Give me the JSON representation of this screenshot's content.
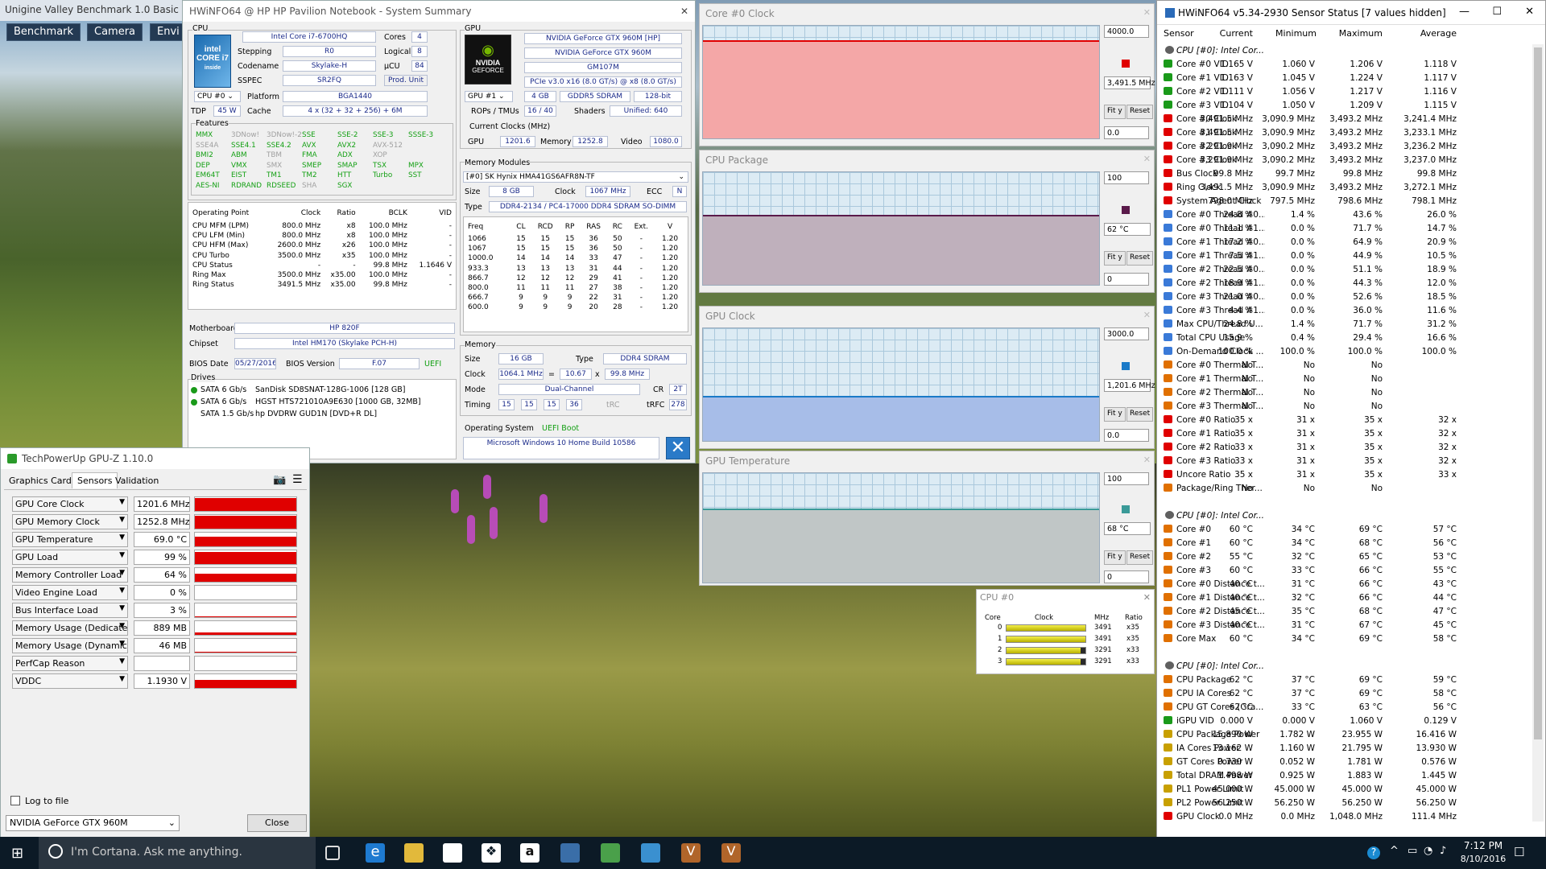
{
  "unigine": {
    "title": "Unigine Valley Benchmark 1.0 Basic (D",
    "tabs": [
      "Benchmark",
      "Camera",
      "Envi"
    ]
  },
  "summary": {
    "title": "HWiNFO64 @ HP HP Pavilion Notebook - System Summary",
    "cpu": {
      "section": "CPU",
      "name": "Intel Core i7-6700HQ",
      "cores_l": "Cores",
      "cores": "4",
      "stepping_l": "Stepping",
      "stepping": "R0",
      "logical_l": "Logical",
      "logical": "8",
      "codename_l": "Codename",
      "codename": "Skylake-H",
      "ucu_l": "µCU",
      "ucu": "84",
      "sspec_l": "SSPEC",
      "sspec": "SR2FQ",
      "produnit": "Prod. Unit",
      "cpusel": "CPU #0",
      "platform_l": "Platform",
      "platform": "BGA1440",
      "tdp_l": "TDP",
      "tdp": "45 W",
      "cache_l": "Cache",
      "cache": "4 x (32 + 32 + 256) + 6M",
      "features_l": "Features",
      "features": [
        [
          "MMX",
          "g"
        ],
        [
          "3DNow!",
          "d"
        ],
        [
          "3DNow!-2",
          "d"
        ],
        [
          "SSE",
          "g"
        ],
        [
          "SSE-2",
          "g"
        ],
        [
          "SSE-3",
          "g"
        ],
        [
          "SSSE-3",
          "g"
        ],
        [
          "SSE4A",
          "d"
        ],
        [
          "SSE4.1",
          "g"
        ],
        [
          "SSE4.2",
          "g"
        ],
        [
          "AVX",
          "g"
        ],
        [
          "AVX2",
          "g"
        ],
        [
          "AVX-512",
          "d"
        ],
        [
          "",
          "d"
        ],
        [
          "BMI2",
          "g"
        ],
        [
          "ABM",
          "g"
        ],
        [
          "TBM",
          "d"
        ],
        [
          "FMA",
          "g"
        ],
        [
          "ADX",
          "g"
        ],
        [
          "XOP",
          "d"
        ],
        [
          "",
          "d"
        ],
        [
          "DEP",
          "g"
        ],
        [
          "VMX",
          "g"
        ],
        [
          "SMX",
          "d"
        ],
        [
          "SMEP",
          "g"
        ],
        [
          "SMAP",
          "g"
        ],
        [
          "TSX",
          "g"
        ],
        [
          "MPX",
          "g"
        ],
        [
          "EM64T",
          "g"
        ],
        [
          "EIST",
          "g"
        ],
        [
          "TM1",
          "g"
        ],
        [
          "TM2",
          "g"
        ],
        [
          "HTT",
          "g"
        ],
        [
          "Turbo",
          "g"
        ],
        [
          "SST",
          "g"
        ],
        [
          "AES-NI",
          "g"
        ],
        [
          "RDRAND",
          "g"
        ],
        [
          "RDSEED",
          "g"
        ],
        [
          "SHA",
          "d"
        ],
        [
          "SGX",
          "g"
        ]
      ],
      "op_head": [
        "Operating Point",
        "Clock",
        "Ratio",
        "BCLK",
        "VID"
      ],
      "op_rows": [
        [
          "CPU MFM (LPM)",
          "800.0 MHz",
          "x8",
          "100.0 MHz",
          "-"
        ],
        [
          "CPU LFM (Min)",
          "800.0 MHz",
          "x8",
          "100.0 MHz",
          "-"
        ],
        [
          "CPU HFM (Max)",
          "2600.0 MHz",
          "x26",
          "100.0 MHz",
          "-"
        ],
        [
          "CPU Turbo",
          "3500.0 MHz",
          "x35",
          "100.0 MHz",
          "-"
        ],
        [
          "CPU Status",
          "-",
          "-",
          "99.8 MHz",
          "1.1646 V"
        ],
        [
          "Ring Max",
          "3500.0 MHz",
          "x35.00",
          "100.0 MHz",
          "-"
        ],
        [
          "Ring Status",
          "3491.5 MHz",
          "x35.00",
          "99.8 MHz",
          "-"
        ]
      ],
      "mobo_l": "Motherboard",
      "mobo": "HP 820F",
      "chipset_l": "Chipset",
      "chipset": "Intel HM170 (Skylake PCH-H)",
      "biosdate_l": "BIOS Date",
      "biosdate": "05/27/2016",
      "biosver_l": "BIOS Version",
      "biosver": "F.07",
      "uefi": "UEFI",
      "drives_l": "Drives",
      "drives": [
        [
          "SATA 6 Gb/s",
          "SanDisk SD8SNAT-128G-1006 [128 GB]"
        ],
        [
          "SATA 6 Gb/s",
          "HGST HTS721010A9E630 [1000 GB, 32MB]"
        ],
        [
          "SATA 1.5 Gb/s",
          "hp      DVDRW GUD1N [DVD+R DL]"
        ]
      ]
    },
    "gpu": {
      "section": "GPU",
      "name1": "NVIDIA GeForce GTX 960M [HP]",
      "name2": "NVIDIA GeForce GTX 960M",
      "chip": "GM107M",
      "pcie": "PCIe v3.0 x16 (8.0 GT/s) @ x8 (8.0 GT/s)",
      "gpusel": "GPU #1",
      "mem": "4 GB",
      "memtype": "GDDR5 SDRAM",
      "bus": "128-bit",
      "rops_l": "ROPs / TMUs",
      "rops": "16 / 40",
      "shaders_l": "Shaders",
      "shaders": "Unified: 640",
      "clocks_l": "Current Clocks (MHz)",
      "gpu_l": "GPU",
      "gpu_clk": "1201.6",
      "memory_l": "Memory",
      "mem_clk": "1252.8",
      "video_l": "Video",
      "video_clk": "1080.0",
      "logo": "NVIDIA",
      "logo2": "GEFORCE"
    },
    "modules": {
      "section": "Memory Modules",
      "sel": "[#0] SK Hynix HMA41GS6AFR8N-TF",
      "size_l": "Size",
      "size": "8 GB",
      "clock_l": "Clock",
      "clock": "1067 MHz",
      "ecc_l": "ECC",
      "ecc": "N",
      "type_l": "Type",
      "type": "DDR4-2134 / PC4-17000 DDR4 SDRAM SO-DIMM",
      "t_head": [
        "Freq",
        "CL",
        "RCD",
        "RP",
        "RAS",
        "RC",
        "Ext.",
        "V"
      ],
      "t_rows": [
        [
          "1066",
          "15",
          "15",
          "15",
          "36",
          "50",
          "-",
          "1.20"
        ],
        [
          "1067",
          "15",
          "15",
          "15",
          "36",
          "50",
          "-",
          "1.20"
        ],
        [
          "1000.0",
          "14",
          "14",
          "14",
          "33",
          "47",
          "-",
          "1.20"
        ],
        [
          "933.3",
          "13",
          "13",
          "13",
          "31",
          "44",
          "-",
          "1.20"
        ],
        [
          "866.7",
          "12",
          "12",
          "12",
          "29",
          "41",
          "-",
          "1.20"
        ],
        [
          "800.0",
          "11",
          "11",
          "11",
          "27",
          "38",
          "-",
          "1.20"
        ],
        [
          "666.7",
          "9",
          "9",
          "9",
          "22",
          "31",
          "-",
          "1.20"
        ],
        [
          "600.0",
          "9",
          "9",
          "9",
          "20",
          "28",
          "-",
          "1.20"
        ]
      ]
    },
    "memory": {
      "section": "Memory",
      "size_l": "Size",
      "size": "16 GB",
      "type_l": "Type",
      "type": "DDR4 SDRAM",
      "clock_l": "Clock",
      "clock": "1064.1 MHz",
      "eq": "=",
      "mult": "10.67",
      "x": "x",
      "bclk": "99.8 MHz",
      "mode_l": "Mode",
      "mode": "Dual-Channel",
      "cr_l": "CR",
      "cr": "2T",
      "timing_l": "Timing",
      "t1": "15",
      "t2": "15",
      "t3": "15",
      "t4": "36",
      "trc_l": "tRC",
      "trfc_l": "tRFC",
      "trfc": "278"
    },
    "os": {
      "label": "Operating System",
      "boot": "UEFI Boot",
      "name": "Microsoft Windows 10 Home Build 10586"
    }
  },
  "graphs": [
    {
      "title": "Core #0 Clock",
      "max": "4000.0",
      "cur": "3,491.5 MHz",
      "min": "0.0",
      "color": "#f4a7a7",
      "swatch": "#e00000",
      "level": 0.87
    },
    {
      "title": "CPU Package",
      "max": "100",
      "cur": "62 °C",
      "min": "0",
      "color": "#bfb0bc",
      "swatch": "#5a1a4a",
      "level": 0.62
    },
    {
      "title": "GPU Clock",
      "max": "3000.0",
      "cur": "1,201.6 MHz",
      "min": "0.0",
      "color": "#a7bde8",
      "swatch": "#1a7ac8",
      "level": 0.4
    },
    {
      "title": "GPU Temperature",
      "max": "100",
      "cur": "68 °C",
      "min": "0",
      "color": "#c0c6c6",
      "swatch": "#3a9a98",
      "level": 0.68
    }
  ],
  "graph_buttons": {
    "fit": "Fit y",
    "reset": "Reset"
  },
  "cpu0": {
    "title": "CPU #0",
    "head": [
      "Core",
      "Clock",
      "MHz",
      "Ratio"
    ],
    "rows": [
      [
        "0",
        "3491",
        "x35"
      ],
      [
        "1",
        "3491",
        "x35"
      ],
      [
        "2",
        "3291",
        "x33"
      ],
      [
        "3",
        "3291",
        "x33"
      ]
    ]
  },
  "gpuz": {
    "title": "TechPowerUp GPU-Z 1.10.0",
    "tabs": [
      "Graphics Card",
      "Sensors",
      "Validation"
    ],
    "rows": [
      {
        "name": "GPU Core Clock",
        "value": "1201.6 MHz",
        "fill": 0.95
      },
      {
        "name": "GPU Memory Clock",
        "value": "1252.8 MHz",
        "fill": 0.95
      },
      {
        "name": "GPU Temperature",
        "value": "69.0 °C",
        "fill": 0.72
      },
      {
        "name": "GPU Load",
        "value": "99 %",
        "fill": 0.9
      },
      {
        "name": "Memory Controller Load",
        "value": "64 %",
        "fill": 0.6
      },
      {
        "name": "Video Engine Load",
        "value": "0 %",
        "fill": 0
      },
      {
        "name": "Bus Interface Load",
        "value": "3 %",
        "fill": 0.05
      },
      {
        "name": "Memory Usage (Dedicated)",
        "value": "889 MB",
        "fill": 0.2
      },
      {
        "name": "Memory Usage (Dynamic)",
        "value": "46 MB",
        "fill": 0.05
      },
      {
        "name": "PerfCap Reason",
        "value": "",
        "fill": 0
      },
      {
        "name": "VDDC",
        "value": "1.1930 V",
        "fill": 0.6
      }
    ],
    "log": "Log to file",
    "device": "NVIDIA GeForce GTX 960M",
    "close": "Close"
  },
  "hws": {
    "title": "HWiNFO64 v5.34-2930 Sensor Status [7 values hidden]",
    "cols": [
      "Sensor",
      "Current",
      "Minimum",
      "Maximum",
      "Average"
    ],
    "rows": [
      [
        "g",
        "CPU [#0]: Intel Cor...",
        "",
        "",
        "",
        ""
      ],
      [
        "v",
        "Core #0 VID",
        "1.165 V",
        "1.060 V",
        "1.206 V",
        "1.118 V"
      ],
      [
        "v",
        "Core #1 VID",
        "1.163 V",
        "1.045 V",
        "1.224 V",
        "1.117 V"
      ],
      [
        "v",
        "Core #2 VID",
        "1.111 V",
        "1.056 V",
        "1.217 V",
        "1.116 V"
      ],
      [
        "v",
        "Core #3 VID",
        "1.104 V",
        "1.050 V",
        "1.209 V",
        "1.115 V"
      ],
      [
        "c",
        "Core #0 Clock",
        "3,491.5 MHz",
        "3,090.9 MHz",
        "3,493.2 MHz",
        "3,241.4 MHz"
      ],
      [
        "c",
        "Core #1 Clock",
        "3,491.5 MHz",
        "3,090.9 MHz",
        "3,493.2 MHz",
        "3,233.1 MHz"
      ],
      [
        "c",
        "Core #2 Clock",
        "3,291.9 MHz",
        "3,090.2 MHz",
        "3,493.2 MHz",
        "3,236.2 MHz"
      ],
      [
        "c",
        "Core #3 Clock",
        "3,291.9 MHz",
        "3,090.2 MHz",
        "3,493.2 MHz",
        "3,237.0 MHz"
      ],
      [
        "c",
        "Bus Clock",
        "99.8 MHz",
        "99.7 MHz",
        "99.8 MHz",
        "99.8 MHz"
      ],
      [
        "c",
        "Ring Clock",
        "3,491.5 MHz",
        "3,090.9 MHz",
        "3,493.2 MHz",
        "3,272.1 MHz"
      ],
      [
        "c",
        "System Agent Clock",
        "798.0 MHz",
        "797.5 MHz",
        "798.6 MHz",
        "798.1 MHz"
      ],
      [
        "u",
        "Core #0 Thread #0...",
        "24.8 %",
        "1.4 %",
        "43.6 %",
        "26.0 %"
      ],
      [
        "u",
        "Core #0 Thread #1...",
        "11.1 %",
        "0.0 %",
        "71.7 %",
        "14.7 %"
      ],
      [
        "u",
        "Core #1 Thread #0...",
        "17.2 %",
        "0.0 %",
        "64.9 %",
        "20.9 %"
      ],
      [
        "u",
        "Core #1 Thread #1...",
        "7.5 %",
        "0.0 %",
        "44.9 %",
        "10.5 %"
      ],
      [
        "u",
        "Core #2 Thread #0...",
        "22.5 %",
        "0.0 %",
        "51.1 %",
        "18.9 %"
      ],
      [
        "u",
        "Core #2 Thread #1...",
        "18.9 %",
        "0.0 %",
        "44.3 %",
        "12.0 %"
      ],
      [
        "u",
        "Core #3 Thread #0...",
        "21.0 %",
        "0.0 %",
        "52.6 %",
        "18.5 %"
      ],
      [
        "u",
        "Core #3 Thread #1...",
        "4.4 %",
        "0.0 %",
        "36.0 %",
        "11.6 %"
      ],
      [
        "u",
        "Max CPU/Thread U...",
        "24.8 %",
        "1.4 %",
        "71.7 %",
        "31.2 %"
      ],
      [
        "u",
        "Total CPU Usage",
        "15.9 %",
        "0.4 %",
        "29.4 %",
        "16.6 %"
      ],
      [
        "u",
        "On-Demand Clock ...",
        "100.0 %",
        "100.0 %",
        "100.0 %",
        "100.0 %"
      ],
      [
        "t",
        "Core #0 Thermal T...",
        "No",
        "No",
        "No",
        ""
      ],
      [
        "t",
        "Core #1 Thermal T...",
        "No",
        "No",
        "No",
        ""
      ],
      [
        "t",
        "Core #2 Thermal T...",
        "No",
        "No",
        "No",
        ""
      ],
      [
        "t",
        "Core #3 Thermal T...",
        "No",
        "No",
        "No",
        ""
      ],
      [
        "c",
        "Core #0 Ratio",
        "35 x",
        "31 x",
        "35 x",
        "32 x"
      ],
      [
        "c",
        "Core #1 Ratio",
        "35 x",
        "31 x",
        "35 x",
        "32 x"
      ],
      [
        "c",
        "Core #2 Ratio",
        "33 x",
        "31 x",
        "35 x",
        "32 x"
      ],
      [
        "c",
        "Core #3 Ratio",
        "33 x",
        "31 x",
        "35 x",
        "32 x"
      ],
      [
        "c",
        "Uncore Ratio",
        "35 x",
        "31 x",
        "35 x",
        "33 x"
      ],
      [
        "t",
        "Package/Ring Ther...",
        "No",
        "No",
        "No",
        ""
      ],
      [
        "e",
        "",
        "",
        "",
        "",
        ""
      ],
      [
        "g",
        "CPU [#0]: Intel Cor...",
        "",
        "",
        "",
        ""
      ],
      [
        "t",
        "Core #0",
        "60 °C",
        "34 °C",
        "69 °C",
        "57 °C"
      ],
      [
        "t",
        "Core #1",
        "60 °C",
        "34 °C",
        "68 °C",
        "56 °C"
      ],
      [
        "t",
        "Core #2",
        "55 °C",
        "32 °C",
        "65 °C",
        "53 °C"
      ],
      [
        "t",
        "Core #3",
        "60 °C",
        "33 °C",
        "66 °C",
        "55 °C"
      ],
      [
        "t",
        "Core #0 Distance t...",
        "40 °C",
        "31 °C",
        "66 °C",
        "43 °C"
      ],
      [
        "t",
        "Core #1 Distance t...",
        "40 °C",
        "32 °C",
        "66 °C",
        "44 °C"
      ],
      [
        "t",
        "Core #2 Distance t...",
        "45 °C",
        "35 °C",
        "68 °C",
        "47 °C"
      ],
      [
        "t",
        "Core #3 Distance t...",
        "40 °C",
        "31 °C",
        "67 °C",
        "45 °C"
      ],
      [
        "t",
        "Core Max",
        "60 °C",
        "34 °C",
        "69 °C",
        "58 °C"
      ],
      [
        "e",
        "",
        "",
        "",
        "",
        ""
      ],
      [
        "g",
        "CPU [#0]: Intel Cor...",
        "",
        "",
        "",
        ""
      ],
      [
        "t",
        "CPU Package",
        "62 °C",
        "37 °C",
        "69 °C",
        "59 °C"
      ],
      [
        "t",
        "CPU IA Cores",
        "62 °C",
        "37 °C",
        "69 °C",
        "58 °C"
      ],
      [
        "t",
        "CPU GT Cores (Gra...",
        "62 °C",
        "33 °C",
        "63 °C",
        "56 °C"
      ],
      [
        "v",
        "iGPU VID",
        "0.000 V",
        "0.000 V",
        "1.060 V",
        "0.129 V"
      ],
      [
        "p",
        "CPU Package Power",
        "15.890 W",
        "1.782 W",
        "23.955 W",
        "16.416 W"
      ],
      [
        "p",
        "IA Cores Power",
        "13.162 W",
        "1.160 W",
        "21.795 W",
        "13.930 W"
      ],
      [
        "p",
        "GT Cores Power",
        "0.730 W",
        "0.052 W",
        "1.781 W",
        "0.576 W"
      ],
      [
        "p",
        "Total DRAM Power",
        "1.498 W",
        "0.925 W",
        "1.883 W",
        "1.445 W"
      ],
      [
        "p",
        "PL1 Power Limit",
        "45.000 W",
        "45.000 W",
        "45.000 W",
        "45.000 W"
      ],
      [
        "p",
        "PL2 Power Limit",
        "56.250 W",
        "56.250 W",
        "56.250 W",
        "56.250 W"
      ],
      [
        "c",
        "GPU Clock",
        "0.0 MHz",
        "0.0 MHz",
        "1,048.0 MHz",
        "111.4 MHz"
      ]
    ]
  },
  "taskbar": {
    "search": "I'm Cortana. Ask me anything.",
    "time": "7:12 PM",
    "date": "8/10/2016"
  },
  "icon_colors": {
    "clock": "#e00000",
    "temp": "#e07000",
    "voltage": "#1a9a1a",
    "usage": "#3a7ad8",
    "power": "#c8a000",
    "group": "#606060"
  }
}
